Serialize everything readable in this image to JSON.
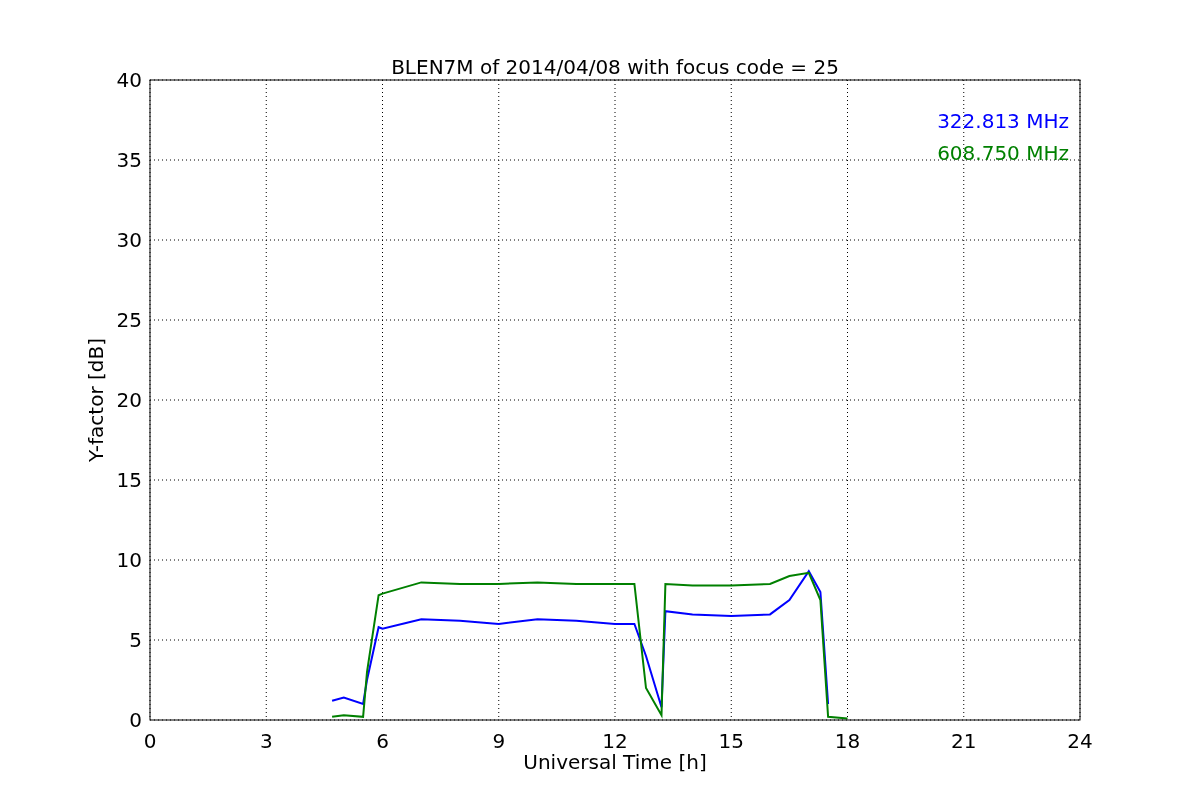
{
  "figure": {
    "chart_data": {
      "type": "line",
      "title": "BLEN7M of 2014/04/08 with focus code = 25",
      "xlabel": "Universal Time [h]",
      "ylabel": "Y-factor [dB]",
      "x": [
        4.7,
        5.0,
        5.5,
        5.6,
        5.9,
        6,
        7,
        8,
        9,
        10,
        11,
        12,
        12.5,
        12.8,
        13.2,
        13.3,
        14,
        15,
        16,
        16.5,
        17,
        17.3,
        17.5,
        18
      ],
      "series": [
        {
          "name": "322.813 MHz",
          "color": "#0000ff",
          "values": [
            1.2,
            1.4,
            1.0,
            2.5,
            5.8,
            5.7,
            6.3,
            6.2,
            6.0,
            6.3,
            6.2,
            6.0,
            6.0,
            4.0,
            0.8,
            6.8,
            6.6,
            6.5,
            6.6,
            7.5,
            9.3,
            8.0,
            1.0,
            null
          ]
        },
        {
          "name": "608.750 MHz",
          "color": "#008000",
          "values": [
            0.2,
            0.3,
            0.2,
            3.0,
            7.8,
            7.9,
            8.6,
            8.5,
            8.5,
            8.6,
            8.5,
            8.5,
            8.5,
            2.0,
            0.3,
            8.5,
            8.4,
            8.4,
            8.5,
            9.0,
            9.2,
            7.5,
            0.2,
            0.1
          ]
        }
      ],
      "grid": true,
      "xlim": [
        0,
        24
      ],
      "ylim": [
        0,
        40
      ],
      "xticks": [
        0,
        3,
        6,
        9,
        12,
        15,
        18,
        21,
        24
      ],
      "yticks": [
        0,
        5,
        10,
        15,
        20,
        25,
        30,
        35,
        40
      ]
    }
  }
}
